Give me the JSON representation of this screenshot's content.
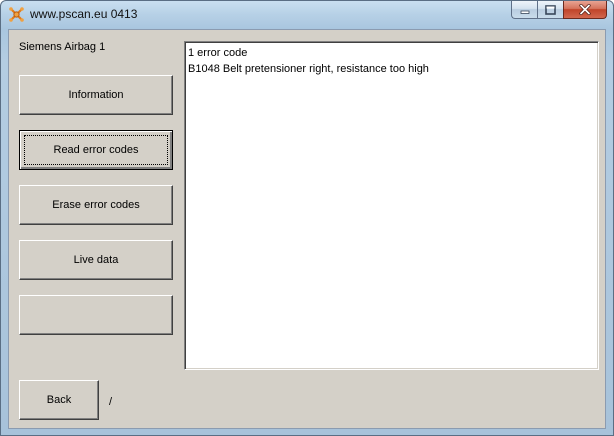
{
  "window": {
    "title": "www.pscan.eu 0413",
    "app_icon": "pscan-logo-icon",
    "caption_buttons": {
      "minimize_icon": "minimize-icon",
      "maximize_icon": "maximize-icon",
      "close_icon": "close-icon"
    }
  },
  "sidebar": {
    "device_label": "Siemens Airbag 1",
    "buttons": [
      {
        "label": "Information"
      },
      {
        "label": "Read error codes"
      },
      {
        "label": "Erase error codes"
      },
      {
        "label": "Live data"
      },
      {
        "label": ""
      }
    ]
  },
  "output": {
    "lines": [
      "1 error code",
      "B1048 Belt pretensioner right, resistance too high"
    ]
  },
  "footer": {
    "back_label": "Back",
    "status_text": "/"
  },
  "colors": {
    "dialog_face": "#d4d0c8",
    "output_background": "#ffffff",
    "close_button": "#c0442a",
    "title_bar": "#b6d0e6"
  }
}
